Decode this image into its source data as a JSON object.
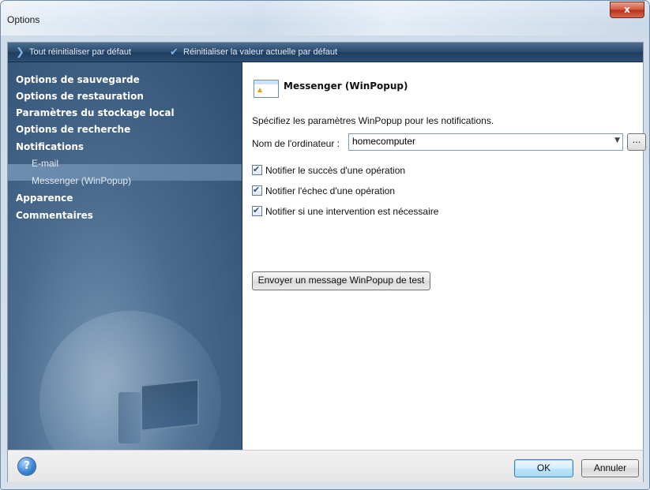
{
  "window": {
    "title": "Options",
    "close_label": "x"
  },
  "toolbar": {
    "reset_all_label": "Tout réinitialiser par défaut",
    "reset_current_label": "Réinitialiser la valeur actuelle par défaut"
  },
  "sidebar": {
    "items": [
      {
        "label": "Options de sauvegarde",
        "level": 1
      },
      {
        "label": "Options de restauration",
        "level": 1
      },
      {
        "label": "Paramètres du stockage local",
        "level": 1
      },
      {
        "label": "Options de recherche",
        "level": 1
      },
      {
        "label": "Notifications",
        "level": 1
      },
      {
        "label": "E-mail",
        "level": 2
      },
      {
        "label": "Messenger (WinPopup)",
        "level": 2,
        "selected": true
      },
      {
        "label": "Apparence",
        "level": 1
      },
      {
        "label": "Commentaires",
        "level": 1
      }
    ]
  },
  "content": {
    "heading": "Messenger (WinPopup)",
    "description": "Spécifiez les paramètres WinPopup pour les notifications.",
    "computer_name_label": "Nom de l'ordinateur :",
    "computer_name_value": "homecomputer",
    "browse_label": "...",
    "checkboxes": [
      {
        "label": "Notifier le succès d'une opération",
        "checked": true
      },
      {
        "label": "Notifier l'échec d'une opération",
        "checked": true
      },
      {
        "label": "Notifier si une intervention est nécessaire",
        "checked": true
      }
    ],
    "test_button": "Envoyer un message WinPopup de test"
  },
  "footer": {
    "help_label": "?",
    "ok_label": "OK",
    "cancel_label": "Annuler"
  },
  "colors": {
    "toolbar": "#29496d",
    "sidebar": "#2c4c70",
    "selected": "#6e8eb0",
    "close": "#d4533a"
  }
}
